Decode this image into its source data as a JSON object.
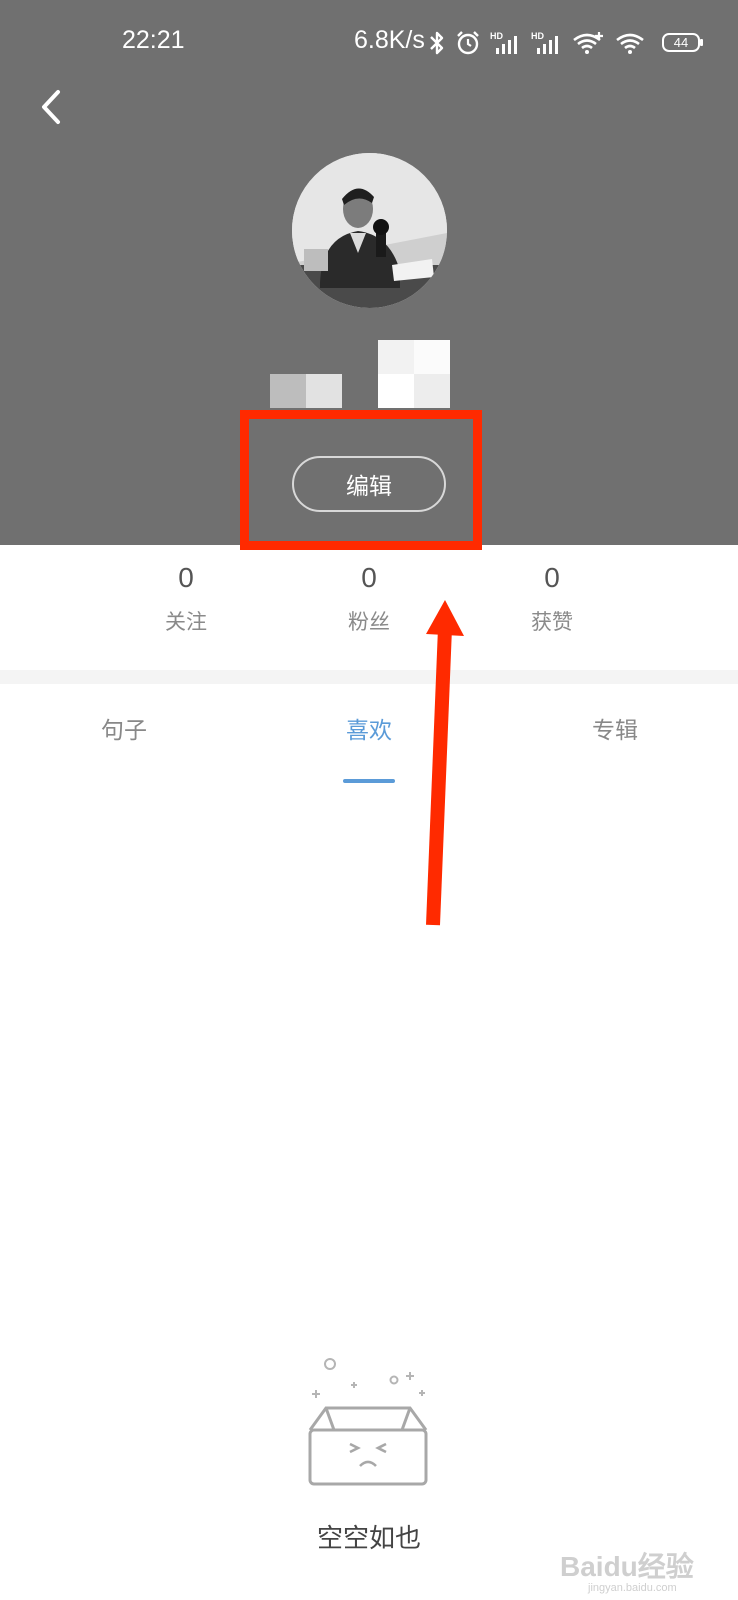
{
  "status_bar": {
    "time": "22:21",
    "network_speed": "6.8K/s",
    "battery_level": "44",
    "icons": [
      "bluetooth-icon",
      "alarm-icon",
      "hd-signal-icon",
      "hd-signal-icon",
      "wifi-plus-icon",
      "wifi-icon"
    ]
  },
  "header": {
    "back_icon": "chevron-left-icon",
    "edit_button_label": "编辑",
    "background_color": "#707070"
  },
  "stats": [
    {
      "value": "0",
      "label": "关注"
    },
    {
      "value": "0",
      "label": "粉丝"
    },
    {
      "value": "0",
      "label": "获赞"
    }
  ],
  "tabs": [
    {
      "label": "句子",
      "active": false
    },
    {
      "label": "喜欢",
      "active": true
    },
    {
      "label": "专辑",
      "active": false
    }
  ],
  "empty_state": {
    "icon": "empty-box-icon",
    "message": "空空如也"
  },
  "annotation": {
    "highlight_color": "#ff2a00"
  },
  "watermark": {
    "text": "Baidu经验",
    "subtext": "jingyan.baidu.com"
  },
  "colors": {
    "accent": "#5b9bd8",
    "annotation": "#ff2a00"
  }
}
